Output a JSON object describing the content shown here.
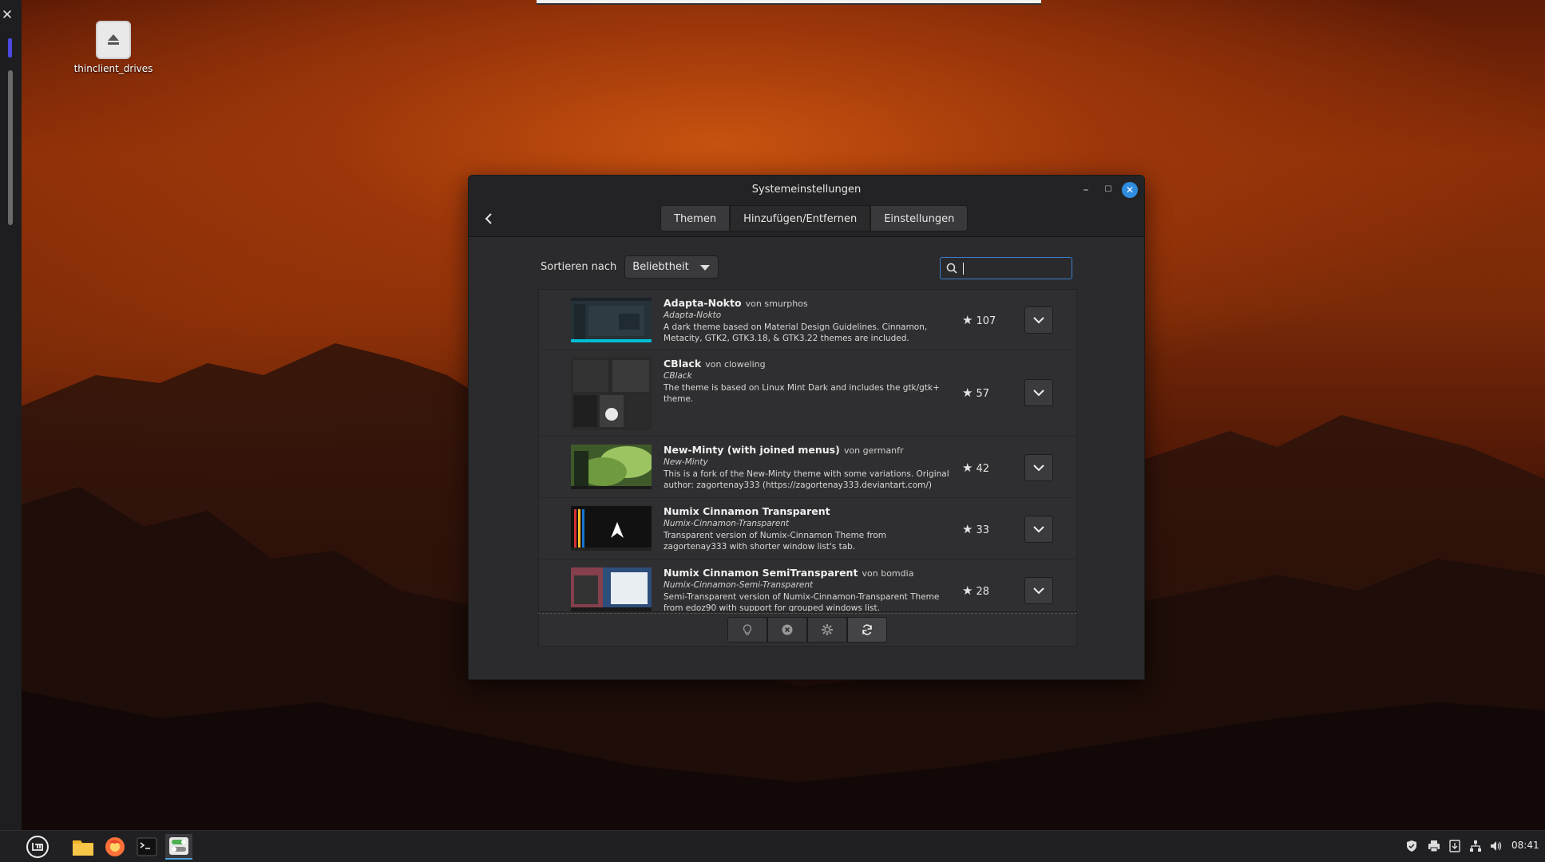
{
  "desktop": {
    "icon_label": "thinclient_drives"
  },
  "window": {
    "title": "Systemeinstellungen",
    "tabs": [
      {
        "label": "Themen"
      },
      {
        "label": "Hinzufügen/Entfernen"
      },
      {
        "label": "Einstellungen"
      }
    ],
    "active_tab": "Hinzufügen/Entfernen",
    "sort_label": "Sortieren nach",
    "sort_value": "Beliebtheit",
    "search_value": "",
    "themes": [
      {
        "name": "Adapta-Nokto",
        "author": "von smurphos",
        "subtitle": "Adapta-Nokto",
        "description": "A dark theme based on Material Design Guidelines. Cinnamon, Metacity, GTK2, GTK3.18, & GTK3.22 themes are included.",
        "score": "107"
      },
      {
        "name": "CBlack",
        "author": "von cloweling",
        "subtitle": "CBlack",
        "description": "The theme is based on Linux Mint Dark and includes the gtk/gtk+ theme.",
        "score": "57"
      },
      {
        "name": "New-Minty (with joined menus)",
        "author": "von germanfr",
        "subtitle": "New-Minty",
        "description": "This is a fork of the New-Minty theme with some variations. Original author: zagortenay333 (https://zagortenay333.deviantart.com/)",
        "score": "42"
      },
      {
        "name": "Numix Cinnamon Transparent",
        "author": "",
        "subtitle": "Numix-Cinnamon-Transparent",
        "description": "Transparent version of Numix-Cinnamon Theme from zagortenay333 with shorter window list's tab.",
        "score": "33"
      },
      {
        "name": "Numix Cinnamon SemiTransparent",
        "author": "von bomdia",
        "subtitle": "Numix-Cinnamon-Semi-Transparent",
        "description": "Semi-Transparent version of Numix-Cinnamon-Transparent Theme from edoz90 with support for grouped windows list.",
        "score": "28"
      }
    ]
  },
  "taskbar": {
    "clock": "08:41"
  },
  "colors": {
    "accent": "#2f8cde",
    "search_border": "#3a7fd0",
    "dock_indicator": "#4b49e0"
  }
}
